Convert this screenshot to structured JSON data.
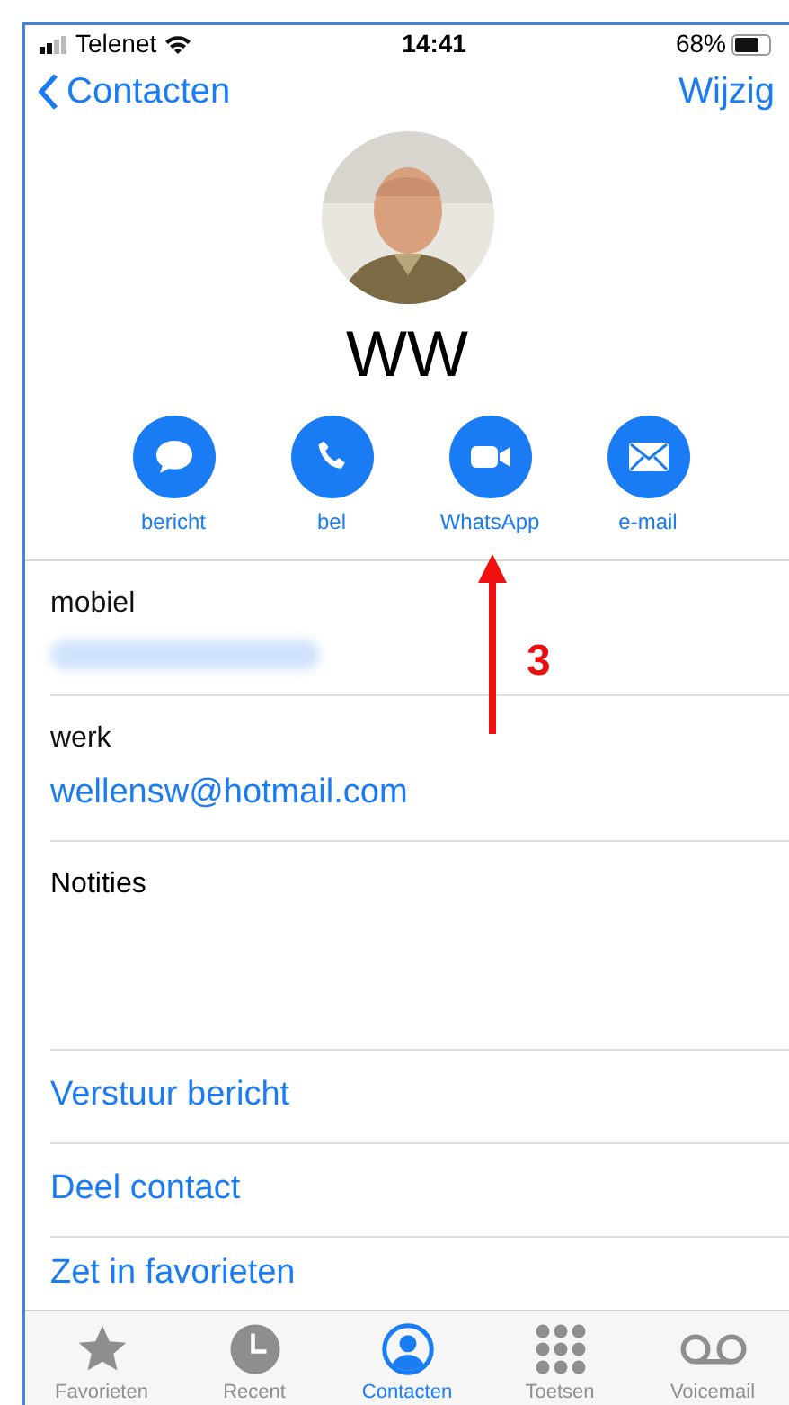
{
  "status_bar": {
    "carrier": "Telenet",
    "time": "14:41",
    "battery": "68%"
  },
  "nav": {
    "back": "Contacten",
    "edit": "Wijzig"
  },
  "contact": {
    "name": "WW"
  },
  "actions": [
    {
      "kind": "message",
      "label": "bericht"
    },
    {
      "kind": "phone",
      "label": "bel"
    },
    {
      "kind": "video",
      "label": "WhatsApp"
    },
    {
      "kind": "mail",
      "label": "e-mail"
    }
  ],
  "fields": [
    {
      "label": "mobiel",
      "kind": "blurred"
    },
    {
      "label": "werk",
      "kind": "text",
      "value": "wellensw@hotmail.com"
    }
  ],
  "notes": {
    "label": "Notities"
  },
  "links": [
    "Verstuur bericht",
    "Deel contact",
    "Zet in favorieten"
  ],
  "annotation": {
    "label": "3"
  },
  "tab_bar": [
    {
      "kind": "star",
      "label": "Favorieten",
      "selected": false
    },
    {
      "kind": "clock",
      "label": "Recent",
      "selected": false
    },
    {
      "kind": "person",
      "label": "Contacten",
      "selected": true
    },
    {
      "kind": "keypad",
      "label": "Toetsen",
      "selected": false
    },
    {
      "kind": "voicemail",
      "label": "Voicemail",
      "selected": false
    }
  ]
}
